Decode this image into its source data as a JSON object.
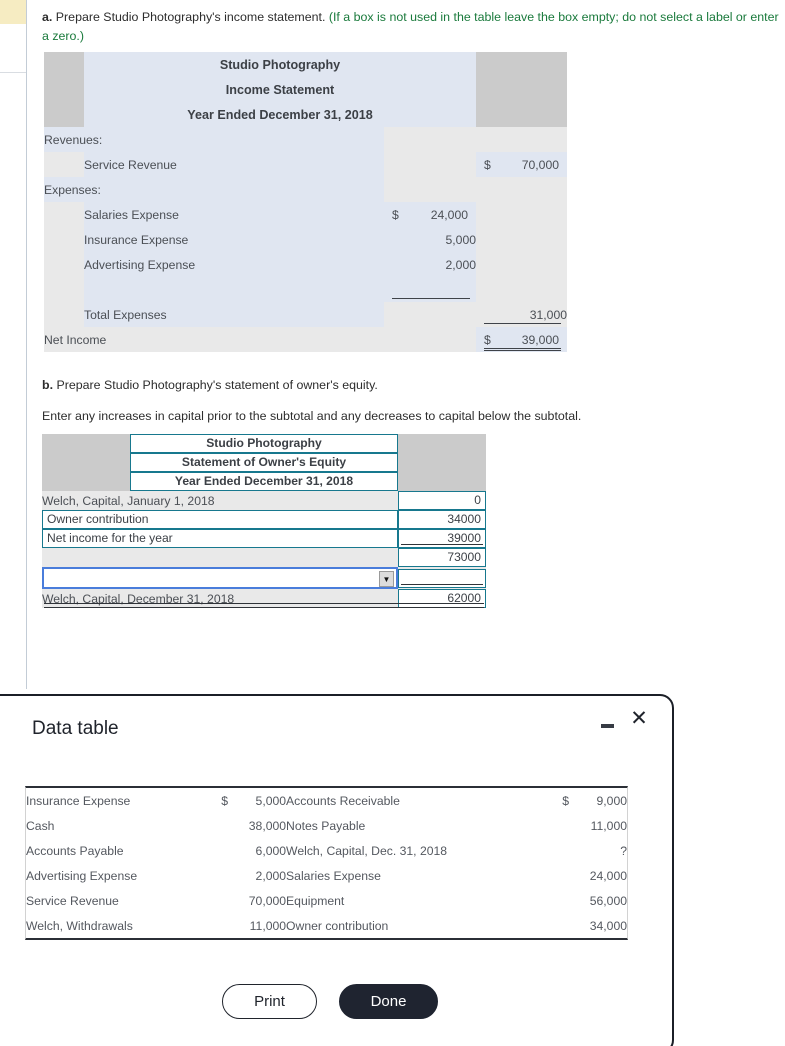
{
  "question_a": {
    "prefix": "a.",
    "text": " Prepare Studio Photography's income statement. ",
    "hint": "(If a box is not used in the table leave the box empty; do not select a label or enter a zero.)"
  },
  "income_statement": {
    "title_line1": "Studio Photography",
    "title_line2": "Income Statement",
    "title_line3": "Year Ended December 31, 2018",
    "rows": {
      "revenues_label": "Revenues:",
      "service_revenue_label": "Service Revenue",
      "service_revenue_dollar": "$",
      "service_revenue_value": "70,000",
      "expenses_label": "Expenses:",
      "salaries_label": "Salaries Expense",
      "salaries_dollar": "$",
      "salaries_value": "24,000",
      "insurance_label": "Insurance Expense",
      "insurance_value": "5,000",
      "advertising_label": "Advertising Expense",
      "advertising_value": "2,000",
      "total_expenses_label": "Total Expenses",
      "total_expenses_value": "31,000",
      "net_income_label": "Net Income",
      "net_income_dollar": "$",
      "net_income_value": "39,000"
    }
  },
  "question_b": {
    "prefix": "b.",
    "text": " Prepare Studio Photography's statement of owner's equity.",
    "instruction": "Enter any increases in capital prior to the subtotal and any decreases to capital below the subtotal."
  },
  "owners_equity": {
    "title_line1": "Studio Photography",
    "title_line2": "Statement of Owner's Equity",
    "title_line3": "Year Ended December 31, 2018",
    "rows": [
      {
        "label": "Welch, Capital, January 1, 2018",
        "label_editable": false,
        "value": "0"
      },
      {
        "label": "Owner contribution",
        "label_editable": true,
        "value": "34000"
      },
      {
        "label": "Net income for the year",
        "label_editable": true,
        "value": "39000"
      },
      {
        "label": "",
        "label_editable": false,
        "value": "73000"
      },
      {
        "label": "",
        "label_editable": true,
        "is_select": true,
        "value": ""
      },
      {
        "label": "Welch, Capital, December 31, 2018",
        "label_editable": false,
        "value": "62000"
      }
    ],
    "select_placeholder": ""
  },
  "dialog": {
    "title": "Data table",
    "minimize_icon": "minimize-icon",
    "close_icon": "close-icon",
    "table": {
      "left": [
        {
          "name": "Insurance Expense",
          "dollar": "$",
          "value": "5,000"
        },
        {
          "name": "Cash",
          "dollar": "",
          "value": "38,000"
        },
        {
          "name": "Accounts Payable",
          "dollar": "",
          "value": "6,000"
        },
        {
          "name": "Advertising Expense",
          "dollar": "",
          "value": "2,000"
        },
        {
          "name": "Service Revenue",
          "dollar": "",
          "value": "70,000"
        },
        {
          "name": "Welch, Withdrawals",
          "dollar": "",
          "value": "11,000"
        }
      ],
      "right": [
        {
          "name": "Accounts Receivable",
          "dollar": "$",
          "value": "9,000"
        },
        {
          "name": "Notes Payable",
          "dollar": "",
          "value": "11,000"
        },
        {
          "name": "Welch, Capital, Dec. 31, 2018",
          "dollar": "",
          "value": "?"
        },
        {
          "name": "Salaries Expense",
          "dollar": "",
          "value": "24,000"
        },
        {
          "name": "Equipment",
          "dollar": "",
          "value": "56,000"
        },
        {
          "name": "Owner contribution",
          "dollar": "",
          "value": "34,000"
        }
      ]
    },
    "print_label": "Print",
    "done_label": "Done"
  },
  "colors": {
    "hint_green": "#1a7a3c",
    "input_border_teal": "#17788e",
    "focus_blue": "#4a7ddb",
    "header_gray": "#cbcbcb",
    "row_blue": "#e0e6f1",
    "row_gray": "#e9e9e9",
    "dialog_dark": "#1f2430"
  }
}
